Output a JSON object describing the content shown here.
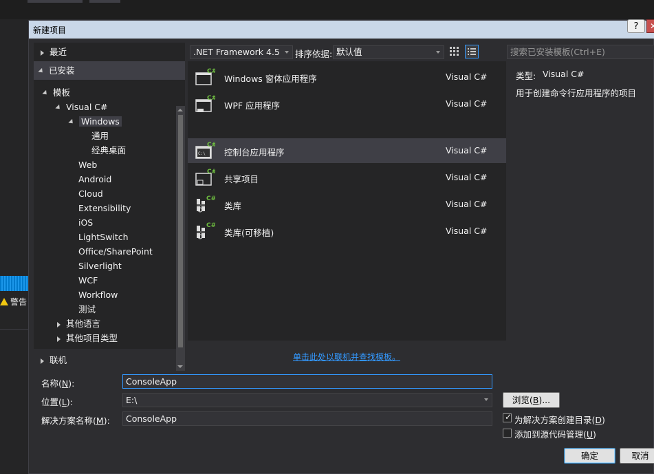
{
  "dialog": {
    "title": "新建项目",
    "help_glyph": "?",
    "close_glyph": "✕"
  },
  "background": {
    "warning_label": "警告"
  },
  "tree": {
    "recent": "最近",
    "installed": "已安装",
    "templates": "模板",
    "visual_csharp": "Visual C#",
    "windows": "Windows",
    "windows_children": [
      "通用",
      "经典桌面"
    ],
    "platforms": [
      "Web",
      "Android",
      "Cloud",
      "Extensibility",
      "iOS",
      "LightSwitch",
      "Office/SharePoint",
      "Silverlight",
      "WCF",
      "Workflow",
      "测试"
    ],
    "other_languages": "其他语言",
    "other_project_types": "其他项目类型",
    "online": "联机"
  },
  "toolbar": {
    "framework": ".NET Framework 4.5",
    "sort_label": "排序依据:",
    "sort_value": "默认值",
    "search_placeholder": "搜索已安装模板(Ctrl+E)"
  },
  "templates": [
    {
      "name": "Windows 窗体应用程序",
      "lang": "Visual C#",
      "icon": "winforms-icon"
    },
    {
      "name": "WPF 应用程序",
      "lang": "Visual C#",
      "icon": "wpf-icon"
    },
    {
      "name": "控制台应用程序",
      "lang": "Visual C#",
      "icon": "console-icon"
    },
    {
      "name": "共享项目",
      "lang": "Visual C#",
      "icon": "shared-project-icon"
    },
    {
      "name": "类库",
      "lang": "Visual C#",
      "icon": "class-library-icon"
    },
    {
      "name": "类库(可移植)",
      "lang": "Visual C#",
      "icon": "portable-library-icon"
    }
  ],
  "online_link": "单击此处以联机并查找模板。",
  "details": {
    "type_label": "类型:",
    "type_value": "Visual C#",
    "description": "用于创建命令行应用程序的项目"
  },
  "form": {
    "name_label": "名称(",
    "name_key": "N",
    "name_label_end": "):",
    "name_value": "ConsoleApp",
    "location_label": "位置(",
    "location_key": "L",
    "location_label_end": "):",
    "location_value": "E:\\",
    "solution_label": "解决方案名称(",
    "solution_key": "M",
    "solution_label_end": "):",
    "solution_value": "ConsoleApp",
    "browse_label": "浏览(",
    "browse_key": "B",
    "browse_label_end": ")...",
    "create_dir_label": "为解决方案创建目录(",
    "create_dir_key": "D",
    "create_dir_end": ")",
    "create_dir_checked": true,
    "source_control_label": "添加到源代码管理(",
    "source_control_key": "U",
    "source_control_end": ")",
    "source_control_checked": false,
    "ok_label": "确定",
    "cancel_label": "取消"
  }
}
